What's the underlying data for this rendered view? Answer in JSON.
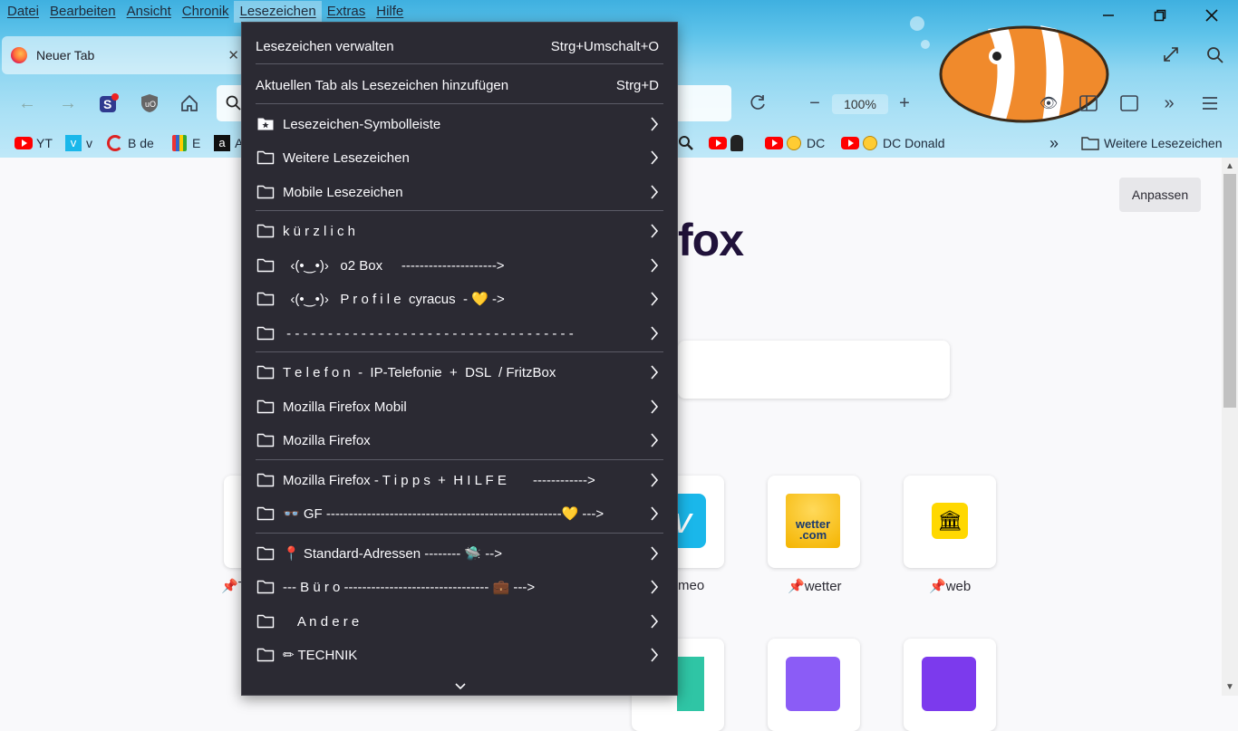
{
  "menubar": {
    "items": [
      "Datei",
      "Bearbeiten",
      "Ansicht",
      "Chronik",
      "Lesezeichen",
      "Extras",
      "Hilfe"
    ],
    "active": "Lesezeichen"
  },
  "tab": {
    "title": "Neuer Tab"
  },
  "toolbar": {
    "zoom": "100%"
  },
  "bookmarks_bar": {
    "items": [
      "YT",
      "v",
      "B de",
      "E",
      "A"
    ],
    "right_items": [
      "DC",
      "DC Donald"
    ],
    "more": "Weitere Lesezeichen"
  },
  "page": {
    "customize": "Anpassen",
    "logo_partial": "fox",
    "tiles": [
      "T",
      "meo",
      "wetter",
      "web"
    ],
    "tile_texts": {
      "wetter": "wetter\n.com"
    }
  },
  "bookmarks_menu": {
    "top": [
      {
        "label": "Lesezeichen verwalten",
        "shortcut": "Strg+Umschalt+O"
      },
      {
        "label": "Aktuellen Tab als Lesezeichen hinzufügen",
        "shortcut": "Strg+D"
      }
    ],
    "items": [
      {
        "label": "Lesezeichen-Symbolleiste",
        "icon": "star-folder-icon"
      },
      {
        "label": "Weitere Lesezeichen",
        "icon": "folder-icon"
      },
      {
        "label": "Mobile Lesezeichen",
        "icon": "folder-icon"
      },
      {
        "label": "k ü r z l i c h",
        "icon": "folder-icon"
      },
      {
        "label": "  ‹(•‿•)›   o2 Box     --------------------->",
        "icon": "folder-icon"
      },
      {
        "label": "  ‹(•‿•)›   P r o f i l e  cyracus  - 💛 ->",
        "icon": "folder-icon"
      },
      {
        "label": " - - - - - - - - - - - - - - - - - - - - - - - - - - - - - - - - - - -",
        "icon": "folder-icon"
      },
      {
        "label": "T e l e f o n  -  IP-Telefonie  +  DSL  / FritzBox",
        "icon": "folder-icon"
      },
      {
        "label": "Mozilla Firefox Mobil",
        "icon": "folder-icon"
      },
      {
        "label": "Mozilla Firefox",
        "icon": "folder-icon"
      },
      {
        "label": "Mozilla Firefox - T i p p s  +  H I L F E       ------------>",
        "icon": "folder-icon"
      },
      {
        "label": "👓 GF ----------------------------------------------------💛 --->",
        "icon": "folder-icon"
      },
      {
        "label": "📍 Standard-Adressen -------- 🛸 -->",
        "icon": "folder-icon"
      },
      {
        "label": "--- B ü r o -------------------------------- 💼 --->",
        "icon": "folder-icon"
      },
      {
        "label": "    A n d e r e",
        "icon": "folder-icon"
      },
      {
        "label": "✏ TECHNIK",
        "icon": "folder-icon"
      }
    ]
  },
  "colors": {
    "menu_bg": "#2b2a33",
    "menu_text": "#fbfbfe",
    "separator": "#5b5b66",
    "chrome_top": "#3fb0e0"
  }
}
